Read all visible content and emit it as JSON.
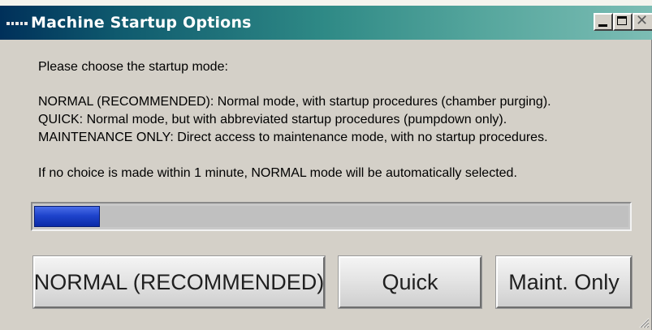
{
  "window": {
    "title": "Machine Startup Options"
  },
  "titlebar_buttons": {
    "minimize": "minimize-icon",
    "maximize": "maximize-icon",
    "close": "close-icon"
  },
  "message": {
    "prompt": "Please choose the startup mode:",
    "normal_desc": "NORMAL (RECOMMENDED): Normal mode, with startup procedures (chamber purging).",
    "quick_desc": "QUICK: Normal mode, but with abbreviated startup procedures (pumpdown only).",
    "maint_desc": "MAINTENANCE ONLY: Direct access to maintenance mode, with no startup procedures.",
    "timeout_note": "If no choice is made within 1 minute, NORMAL mode will be automatically selected."
  },
  "progress": {
    "fraction": 0.11,
    "fill_color": "#1f44cc"
  },
  "buttons": {
    "normal": "NORMAL (RECOMMENDED)",
    "quick": "Quick",
    "maint": "Maint. Only"
  }
}
